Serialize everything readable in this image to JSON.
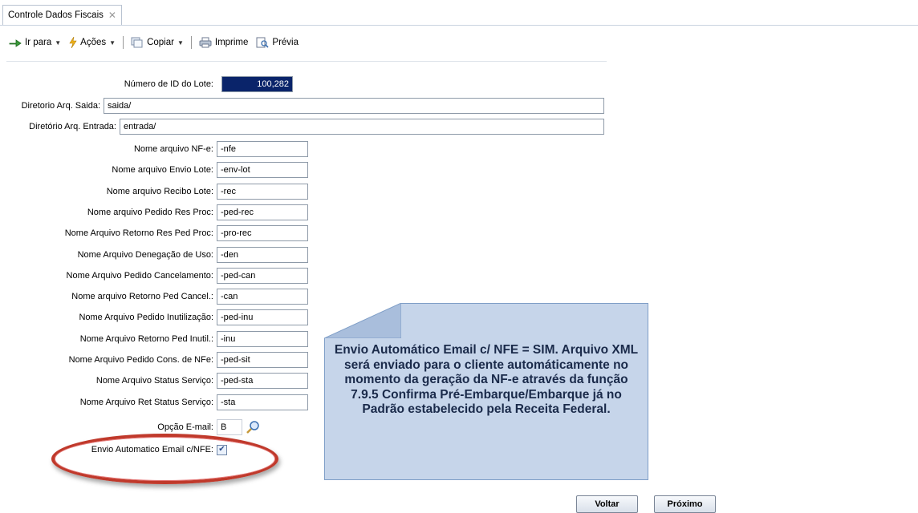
{
  "tab": {
    "title": "Controle Dados Fiscais",
    "close": "✕"
  },
  "toolbar": {
    "goto": "Ir para",
    "actions": "Ações",
    "copy": "Copiar",
    "print": "Imprime",
    "preview": "Prévia"
  },
  "form": {
    "lote_label": "Número de ID do Lote:",
    "lote_value": "100,282",
    "saida_label": "Diretorio Arq. Saida:",
    "saida_value": "saida/",
    "entrada_label": "Diretório Arq. Entrada:",
    "entrada_value": "entrada/",
    "fields": [
      {
        "label": "Nome arquivo NF-e:",
        "value": "-nfe"
      },
      {
        "label": "Nome arquivo Envio Lote:",
        "value": "-env-lot"
      },
      {
        "label": "Nome arquivo Recibo Lote:",
        "value": "-rec"
      },
      {
        "label": "Nome arquivo Pedido Res Proc:",
        "value": "-ped-rec"
      },
      {
        "label": "Nome Arquivo Retorno Res Ped Proc:",
        "value": "-pro-rec"
      },
      {
        "label": "Nome Arquivo Denegação de Uso:",
        "value": "-den"
      },
      {
        "label": "Nome Arquivo Pedido Cancelamento:",
        "value": "-ped-can"
      },
      {
        "label": "Nome arquivo Retorno Ped Cancel.:",
        "value": "-can"
      },
      {
        "label": "Nome Arquivo Pedido Inutilização:",
        "value": "-ped-inu"
      },
      {
        "label": "Nome Arquivo Retorno Ped Inutil.:",
        "value": "-inu"
      },
      {
        "label": "Nome Arquivo Pedido Cons. de NFe:",
        "value": "-ped-sit"
      },
      {
        "label": "Nome Arquivo Status Serviço:",
        "value": "-ped-sta"
      },
      {
        "label": "Nome Arquivo Ret Status Serviço:",
        "value": "-sta"
      }
    ],
    "email_option_label": "Opção E-mail:",
    "email_option_value": "B",
    "auto_email_label": "Envio Automatico Email c/NFE:",
    "auto_email_checked": true
  },
  "note": {
    "text": "Envio Automático Email c/ NFE = SIM. Arquivo XML será enviado para o cliente automáticamente no momento da geração da NF-e através da função 7.9.5 Confirma Pré-Embarque/Embarque já no Padrão estabelecido pela Receita Federal."
  },
  "buttons": {
    "back": "Voltar",
    "next": "Próximo"
  },
  "colors": {
    "note_bg": "#c6d5ea",
    "highlight": "#c0392b",
    "selected_input": "#0a246a"
  }
}
